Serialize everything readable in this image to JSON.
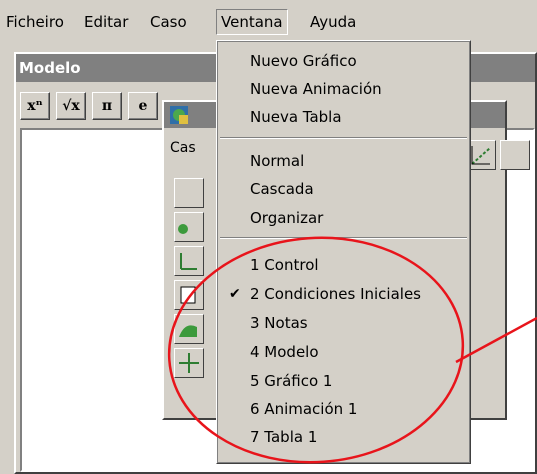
{
  "menubar": {
    "items": [
      {
        "label": "Ficheiro"
      },
      {
        "label": "Editar"
      },
      {
        "label": "Caso"
      },
      {
        "label": "Ventana"
      },
      {
        "label": "Ayuda"
      }
    ]
  },
  "window_model": {
    "title": "Modelo",
    "toolbar": [
      "xⁿ",
      "√x",
      "π",
      "e"
    ]
  },
  "window_inner": {
    "label": "Cas"
  },
  "dropdown": {
    "group1": [
      "Nuevo Gráfico",
      "Nueva Animación",
      "Nueva Tabla"
    ],
    "group2": [
      "Normal",
      "Cascada",
      "Organizar"
    ],
    "group3": [
      {
        "label": "1 Control",
        "checked": false
      },
      {
        "label": "2 Condiciones Iniciales",
        "checked": true
      },
      {
        "label": "3 Notas",
        "checked": false
      },
      {
        "label": "4 Modelo",
        "checked": false
      },
      {
        "label": "5 Gráfico 1",
        "checked": false
      },
      {
        "label": "6 Animación 1",
        "checked": false
      },
      {
        "label": "7 Tabla 1",
        "checked": false
      }
    ],
    "check_mark": "✔"
  },
  "annotation": {
    "color": "#e8141b"
  }
}
